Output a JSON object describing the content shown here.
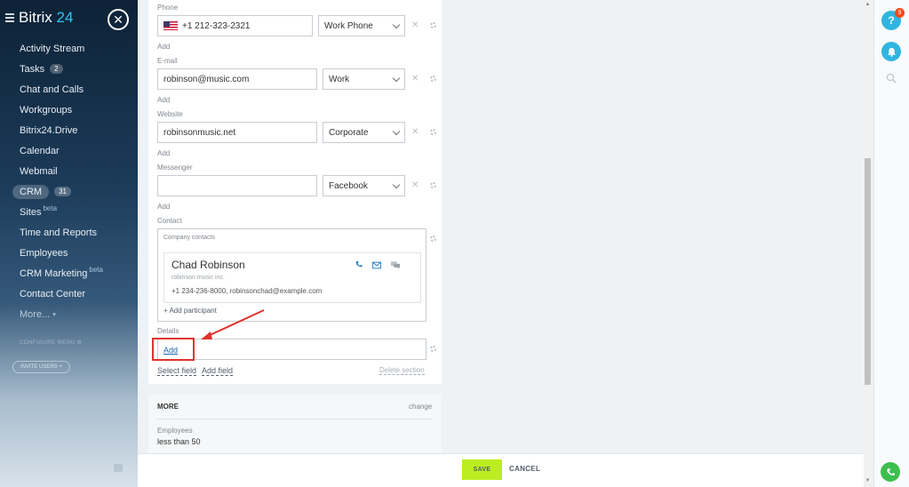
{
  "sidebar": {
    "logo_main": "Bitrix",
    "logo_num": "24",
    "items": [
      {
        "label": "Activity Stream"
      },
      {
        "label": "Tasks",
        "badge": "2"
      },
      {
        "label": "Chat and Calls"
      },
      {
        "label": "Workgroups"
      },
      {
        "label": "Bitrix24.Drive"
      },
      {
        "label": "Calendar"
      },
      {
        "label": "Webmail"
      },
      {
        "label": "CRM",
        "badge": "31"
      },
      {
        "label": "Sites",
        "sup": "beta"
      },
      {
        "label": "Time and Reports"
      },
      {
        "label": "Employees"
      },
      {
        "label": "CRM Marketing",
        "sup": "beta"
      },
      {
        "label": "Contact Center"
      },
      {
        "label": "More..."
      }
    ],
    "configure_menu": "CONFIGURE MENU",
    "invite_users": "INVITE USERS"
  },
  "form": {
    "phone": {
      "label": "Phone",
      "value": "+1 212-323-2321",
      "type": "Work Phone",
      "add": "Add"
    },
    "email": {
      "label": "E-mail",
      "value": "robinson@music.com",
      "type": "Work",
      "add": "Add"
    },
    "website": {
      "label": "Website",
      "value": "robinsonmusic.net",
      "type": "Corporate",
      "add": "Add"
    },
    "messenger": {
      "label": "Messenger",
      "value": "",
      "type": "Facebook",
      "add": "Add"
    },
    "contact": {
      "label": "Contact",
      "box_label": "Company contacts",
      "name": "Chad Robinson",
      "company": "robinson music inc.",
      "info": "+1 234-236-8000, robinsonchad@example.com",
      "add_participant": "+ Add participant"
    },
    "details": {
      "label": "Details",
      "add": "Add",
      "select_field": "Select field",
      "add_field": "Add field",
      "delete_section": "Delete section"
    }
  },
  "more": {
    "title": "MORE",
    "change": "change",
    "employees_label": "Employees",
    "employees_value": "less than 50"
  },
  "actions": {
    "save": "SAVE",
    "cancel": "CANCEL"
  },
  "rail": {
    "help_badge": "9"
  },
  "colors": {
    "accent": "#2fc6f6",
    "save": "#bbed21",
    "highlight": "#e0332e"
  }
}
